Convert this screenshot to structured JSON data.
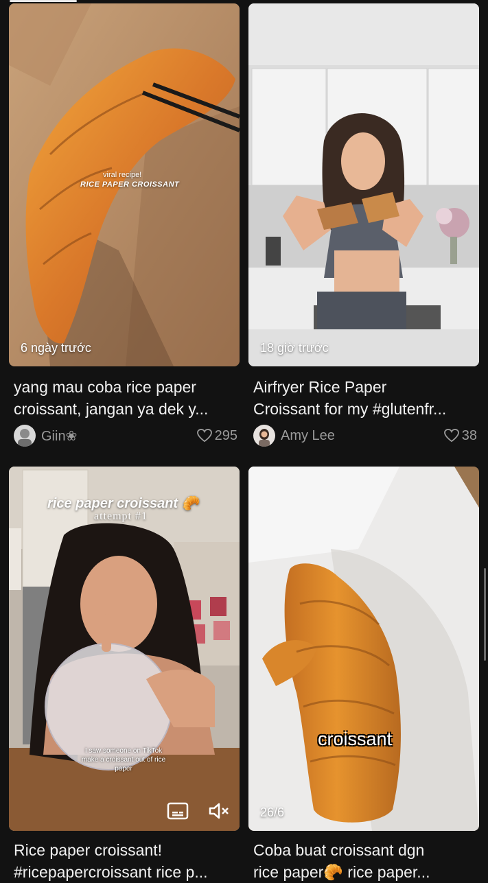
{
  "feed": [
    {
      "overlay_lines": [
        "viral recipe!",
        "RICE PAPER CROISSANT"
      ],
      "date": "6 ngày trước",
      "title_lines": [
        "yang mau coba rice paper",
        "croissant, jangan ya dek y..."
      ],
      "author": "Giin❀",
      "likes": "295"
    },
    {
      "date": "18 giờ trước",
      "title_lines": [
        "Airfryer Rice Paper",
        "Croissant for my #glutenfr..."
      ],
      "author": "Amy Lee",
      "likes": "38"
    },
    {
      "overlay_title": "rice paper croissant 🥐",
      "overlay_sub": "attempt #1",
      "caption_lines": [
        "I saw someone on TikTok",
        "make a croissant out of rice",
        "paper"
      ],
      "title_lines": [
        "Rice paper croissant!",
        "#ricepapercroissant rice p..."
      ]
    },
    {
      "overlay_word": "croissant",
      "date": "26/6",
      "title_lines": [
        "Coba buat croissant dgn",
        "rice paper🥐 rice paper..."
      ]
    }
  ]
}
